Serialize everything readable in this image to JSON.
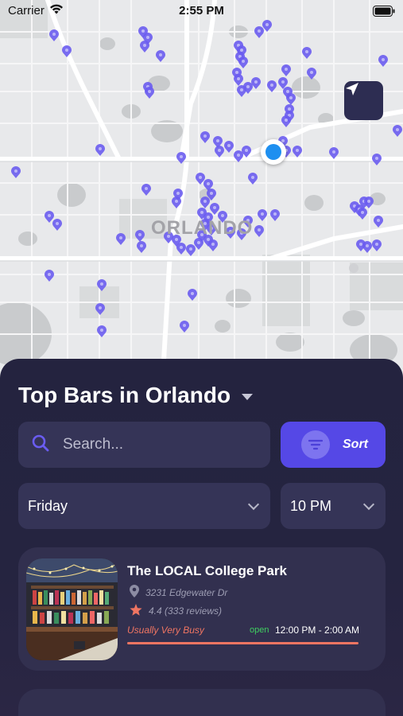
{
  "status_bar": {
    "carrier": "Carrier",
    "time": "2:55 PM"
  },
  "map": {
    "city_label": "ORLANDO"
  },
  "sheet": {
    "title": "Top Bars in Orlando",
    "search": {
      "placeholder": "Search...",
      "value": ""
    },
    "sort_label": "Sort",
    "day_select": {
      "value": "Friday"
    },
    "time_select": {
      "value": "10 PM"
    },
    "bars": [
      {
        "name": "The LOCAL College Park",
        "address": "3231 Edgewater Dr",
        "rating": "4.4 (333 reviews)",
        "busyness": "Usually Very Busy",
        "open_status": "open",
        "hours": "12:00 PM - 2:00 AM"
      }
    ]
  },
  "colors": {
    "sheet_bg": "#24233f",
    "card_bg": "#32304f",
    "accent": "#5548e6",
    "pin": "#6a5cf0",
    "busy": "#f07562",
    "open": "#3fcf60",
    "user_location": "#1e8ff0"
  },
  "icons": [
    "wifi-icon",
    "battery-icon",
    "locate-arrow-icon",
    "search-icon",
    "filter-icon",
    "chevron-down-icon",
    "map-pin-icon",
    "star-icon"
  ]
}
